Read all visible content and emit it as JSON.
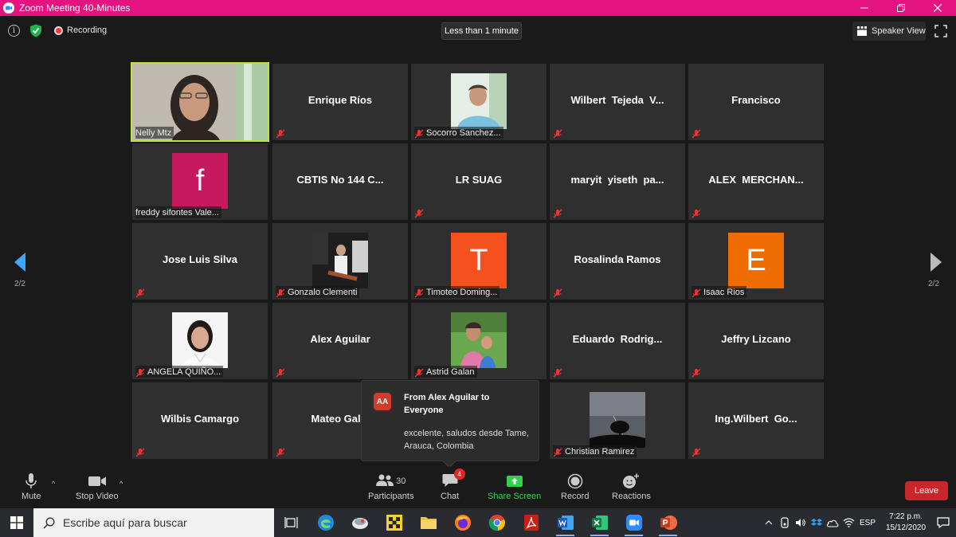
{
  "window": {
    "title": "Zoom Meeting 40-Minutes"
  },
  "topbar": {
    "recording_label": "Recording",
    "timer_label": "Less than 1 minute",
    "view_label": "Speaker View"
  },
  "pager": {
    "left_label": "2/2",
    "right_label": "2/2"
  },
  "participants": [
    {
      "name": "Nelly Mtz",
      "display": "photo",
      "active": true,
      "muted": false
    },
    {
      "name": "Enrique Ríos",
      "display": "name",
      "muted": true
    },
    {
      "name": "Socorro Sanchez...",
      "display": "photo",
      "muted": true
    },
    {
      "name": "Wilbert  Tejeda  V...",
      "display": "name",
      "muted": true
    },
    {
      "name": "Francisco",
      "display": "name",
      "muted": true
    },
    {
      "name": "freddy sifontes Vale...",
      "display": "letter",
      "letter": "f",
      "color": "#c6195e",
      "muted": false
    },
    {
      "name": "CBTIS No 144 C...",
      "display": "name",
      "muted": false
    },
    {
      "name": "LR SUAG",
      "display": "name",
      "muted": true
    },
    {
      "name": "maryit  yiseth  pa...",
      "display": "name",
      "muted": true
    },
    {
      "name": "ALEX  MERCHAN...",
      "display": "name",
      "muted": true
    },
    {
      "name": "Jose Luis Silva",
      "display": "name",
      "muted": true
    },
    {
      "name": "Gonzalo Clementi",
      "display": "photo",
      "muted": true
    },
    {
      "name": "Timoteo Doming...",
      "display": "letter",
      "letter": "T",
      "color": "#f4511e",
      "muted": true
    },
    {
      "name": "Rosalinda Ramos",
      "display": "name",
      "muted": true
    },
    {
      "name": "Isaac Rios",
      "display": "letter",
      "letter": "E",
      "color": "#ef6c00",
      "muted": true
    },
    {
      "name": "ANGELA QUIÑO...",
      "display": "photo",
      "muted": true
    },
    {
      "name": "Alex Aguilar",
      "display": "name",
      "muted": true
    },
    {
      "name": "Astrid Galan",
      "display": "photo",
      "muted": true
    },
    {
      "name": "Eduardo  Rodrig...",
      "display": "name",
      "muted": true
    },
    {
      "name": "Jeffry Lizcano",
      "display": "name",
      "muted": true
    },
    {
      "name": "Wilbis Camargo",
      "display": "name",
      "muted": true
    },
    {
      "name": "Mateo Galle",
      "display": "name",
      "muted": true
    },
    {
      "name": "",
      "display": "empty",
      "muted": false
    },
    {
      "name": "Christian Ramirez",
      "display": "photo",
      "muted": true
    },
    {
      "name": "Ing.Wilbert  Go...",
      "display": "name",
      "muted": true
    }
  ],
  "chat_popup": {
    "initials": "AA",
    "from": "From Alex Aguilar to Everyone",
    "message": "excelente, saludos desde Tame, Arauca, Colombia"
  },
  "toolbar": {
    "mute_label": "Mute",
    "video_label": "Stop Video",
    "participants_label": "Participants",
    "participants_count": "30",
    "chat_label": "Chat",
    "chat_badge": "4",
    "share_label": "Share Screen",
    "record_label": "Record",
    "reactions_label": "Reactions",
    "leave_label": "Leave"
  },
  "taskbar": {
    "search_placeholder": "Escribe aquí para buscar",
    "language": "ESP",
    "time": "7:22 p.m.",
    "date": "15/12/2020"
  },
  "colors": {
    "title_bar": "#e3137f",
    "active_speaker": "#bde539",
    "leave": "#c8262b",
    "share_green": "#32d04b"
  }
}
